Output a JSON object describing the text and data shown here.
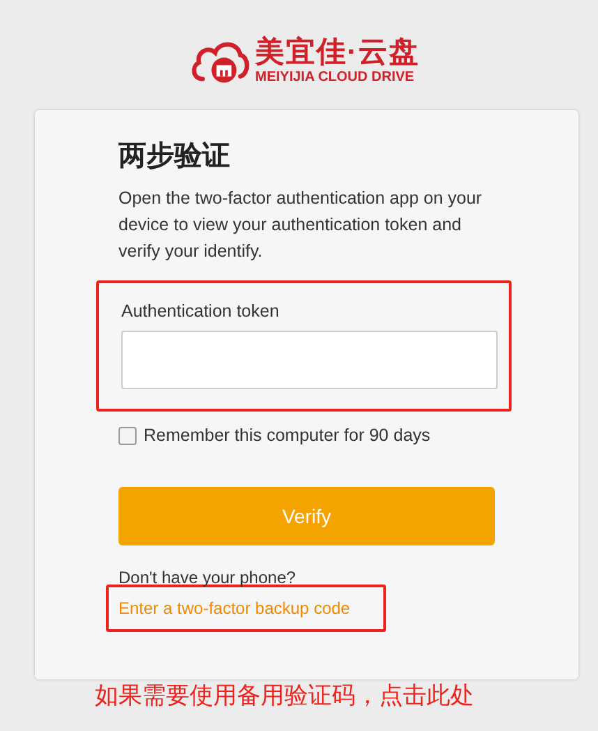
{
  "logo": {
    "name": "美宜佳·云盘",
    "subtitle": "MEIYIJIA CLOUD DRIVE"
  },
  "title": "两步验证",
  "description": "Open the two-factor authentication app on your device to view your authentication token and verify your identify.",
  "token_field": {
    "label": "Authentication token",
    "highlighted": true
  },
  "remember": {
    "label": "Remember this computer for 90 days",
    "checked": false
  },
  "verify_button": "Verify",
  "prompt": "Don't have your phone?",
  "backup_link": {
    "label": "Enter a two-factor backup code",
    "highlighted": true
  },
  "annotation": "如果需要使用备用验证码，点击此处"
}
